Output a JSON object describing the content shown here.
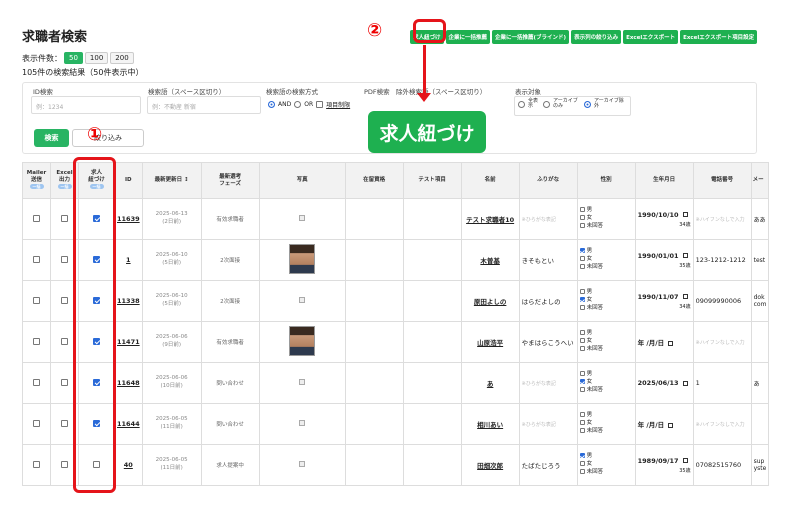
{
  "page": {
    "title": "求職者検索",
    "display_count_label": "表示件数：",
    "page_sizes": [
      "50",
      "100",
      "200"
    ],
    "result_text": "105件の検索結果（50件表示中）"
  },
  "annotations": {
    "circle1": "①",
    "circle2": "②",
    "callout": "求人紐づけ"
  },
  "top_buttons": [
    "求人紐づけ",
    "企業に一括推薦",
    "企業に一括推薦(ブラインド)",
    "表示列の絞り込み",
    "Excelエクスポート",
    "Excelエクスポート項目設定"
  ],
  "search": {
    "id_label": "ID検索",
    "id_placeholder": "例：1234",
    "keyword_label": "検索語（スペース区切り）",
    "keyword_placeholder": "例：不動産 新宿",
    "method_label": "検索語の検索方式",
    "and_label": "AND",
    "or_label": "OR",
    "item_limit_label": "項目制限",
    "pdf_label": "PDF検索",
    "exclude_label": "除外検索語（スペース区切り）",
    "target_label": "表示対象",
    "target_all": "全表示",
    "target_archive_only": "アーカイブのみ",
    "target_archive_excluded": "アーカイブ除外",
    "search_button": "検索",
    "filter_button": "絞り込み"
  },
  "table": {
    "headers": {
      "mailer": "Mailer\n送信",
      "excel": "Excel\n出力",
      "job_link": "求人\n紐づけ",
      "tag": "一括",
      "id": "ID",
      "updated": "最新更新日 ↕",
      "phase": "最新選考\nフェーズ",
      "photo": "写真",
      "residence": "在留資格",
      "test_item": "テスト項目",
      "name": "名前",
      "furigana": "ふりがな",
      "gender": "性別",
      "birthday": "生年月日",
      "phone": "電話番号",
      "mail": "メー"
    },
    "gender_options": [
      "男",
      "女",
      "未回答"
    ],
    "furigana_placeholder": "※ひらがな表記",
    "phone_placeholder": "※ハイフンなしで入力",
    "empty_date": "年 /月/日",
    "rows": [
      {
        "id": "11639",
        "date": "2025-06-13",
        "ago": "(2日前)",
        "phase": "有効求職者",
        "photo": "none",
        "name": "テスト求職者10",
        "furigana": "",
        "gender": -1,
        "birthday": "1990/10/10",
        "age": "34歳",
        "phone": "",
        "mail": "ああ",
        "job_checked": true
      },
      {
        "id": "1",
        "date": "2025-06-10",
        "ago": "(5日前)",
        "phase": "2次面接",
        "photo": "face",
        "name": "木曽基",
        "furigana": "きそもとい",
        "gender": 0,
        "birthday": "1990/01/01",
        "age": "35歳",
        "phone": "123-1212-1212",
        "mail": "test",
        "job_checked": true
      },
      {
        "id": "11338",
        "date": "2025-06-10",
        "ago": "(5日前)",
        "phase": "2次面接",
        "photo": "none",
        "name": "原田よしの",
        "furigana": "はらだよしの",
        "gender": 1,
        "birthday": "1990/11/07",
        "age": "34歳",
        "phone": "09099990006",
        "mail": "dok com",
        "job_checked": true
      },
      {
        "id": "11471",
        "date": "2025-06-06",
        "ago": "(9日前)",
        "phase": "有効求職者",
        "photo": "face",
        "name": "山原浩平",
        "furigana": "やまはらこうへい",
        "gender": -1,
        "birthday": "",
        "age": "",
        "phone": "",
        "mail": "",
        "job_checked": true
      },
      {
        "id": "11648",
        "date": "2025-06-06",
        "ago": "(10日前)",
        "phase": "問い合わせ",
        "photo": "none",
        "name": "あ",
        "furigana": "",
        "gender": 1,
        "birthday": "2025/06/13",
        "age": "",
        "phone": "1",
        "mail": "あ",
        "job_checked": true
      },
      {
        "id": "11644",
        "date": "2025-06-05",
        "ago": "(11日前)",
        "phase": "問い合わせ",
        "photo": "none",
        "name": "相川あい",
        "furigana": "",
        "gender": -1,
        "birthday": "",
        "age": "",
        "phone": "",
        "mail": "",
        "job_checked": true
      },
      {
        "id": "40",
        "date": "2025-06-05",
        "ago": "(11日前)",
        "phase": "求人提案中",
        "photo": "none",
        "name": "田畑次郎",
        "furigana": "たばたじろう",
        "gender": 0,
        "birthday": "1989/09/17",
        "age": "35歳",
        "phone": "07082515760",
        "mail": "sup yste",
        "job_checked": false
      }
    ]
  },
  "colors": {
    "accent_green": "#1eb050",
    "annotation_red": "#e5141a",
    "check_blue": "#2a6ad8"
  }
}
